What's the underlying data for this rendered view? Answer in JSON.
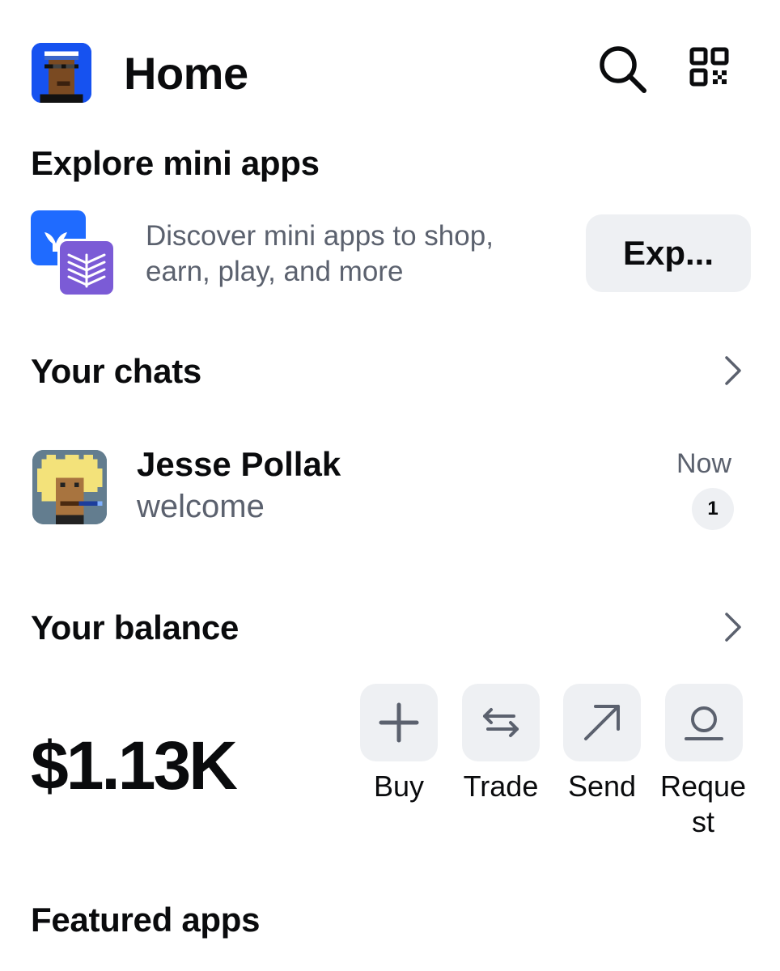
{
  "header": {
    "title": "Home",
    "icons": [
      "avatar",
      "search-icon",
      "qr-code-icon"
    ]
  },
  "explore": {
    "title": "Explore mini apps",
    "description_line1": "Discover mini apps to shop,",
    "description_line2": "earn, play, and more",
    "button_label": "Exp..."
  },
  "chats": {
    "title": "Your chats",
    "items": [
      {
        "name": "Jesse Pollak",
        "message": "welcome",
        "time": "Now",
        "unread": "1"
      }
    ]
  },
  "balance": {
    "title": "Your balance",
    "value": "$1.13K",
    "actions": [
      {
        "label": "Buy",
        "icon": "plus-icon"
      },
      {
        "label": "Trade",
        "icon": "swap-arrows-icon"
      },
      {
        "label": "Send",
        "icon": "arrow-up-right-icon"
      },
      {
        "label": "Request",
        "icon": "receive-icon"
      }
    ]
  },
  "featured": {
    "title": "Featured apps"
  },
  "colors": {
    "brand_blue": "#1652f0",
    "muted_text": "#5b616e",
    "chip_bg": "#eef0f3",
    "purple": "#7b5bd6"
  }
}
